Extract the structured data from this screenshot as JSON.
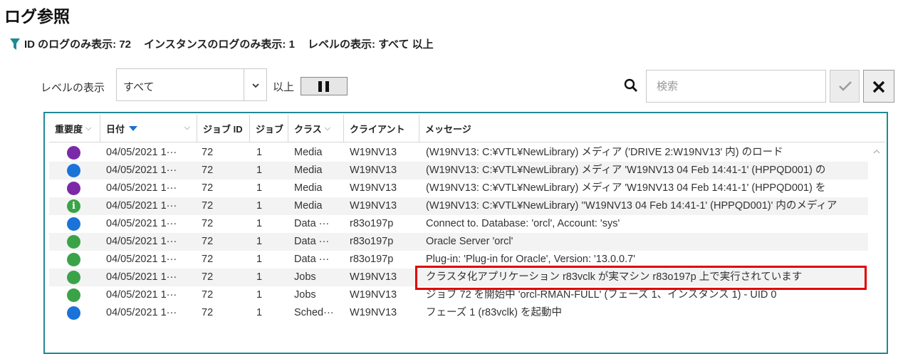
{
  "page": {
    "title": "ログ参照"
  },
  "filter_summary": {
    "segments": [
      "ID のログのみ表示: 72",
      "インスタンスのログのみ表示: 1",
      "レベルの表示: すべて 以上"
    ]
  },
  "toolbar": {
    "level_label": "レベルの表示",
    "level_value": "すべて",
    "above_label": "以上",
    "search_placeholder": "検索"
  },
  "grid": {
    "headers": {
      "severity": "重要度",
      "date": "日付",
      "job_id": "ジョブ ID",
      "job": "ジョブ",
      "class": "クラス",
      "client": "クライアント",
      "message": "メッセージ"
    },
    "rows": [
      {
        "severity": "purple",
        "date": "04/05/2021 1···",
        "job_id": "72",
        "job": "1",
        "class": "Media",
        "client": "W19NV13",
        "message": "(W19NV13: C:¥VTL¥NewLibrary) メディア ('DRIVE 2:W19NV13' 内) のロード"
      },
      {
        "severity": "blue",
        "date": "04/05/2021 1···",
        "job_id": "72",
        "job": "1",
        "class": "Media",
        "client": "W19NV13",
        "message": "(W19NV13: C:¥VTL¥NewLibrary) メディア 'W19NV13 04 Feb 14:41-1' (HPPQD001) の"
      },
      {
        "severity": "purple",
        "date": "04/05/2021 1···",
        "job_id": "72",
        "job": "1",
        "class": "Media",
        "client": "W19NV13",
        "message": "(W19NV13: C:¥VTL¥NewLibrary) メディア 'W19NV13 04 Feb 14:41-1' (HPPQD001) を"
      },
      {
        "severity": "info",
        "date": "04/05/2021 1···",
        "job_id": "72",
        "job": "1",
        "class": "Media",
        "client": "W19NV13",
        "message": "(W19NV13: C:¥VTL¥NewLibrary) ''W19NV13 04 Feb 14:41-1' (HPPQD001)' 内のメディア"
      },
      {
        "severity": "blue",
        "date": "04/05/2021 1···",
        "job_id": "72",
        "job": "1",
        "class": "Data ···",
        "client": "r83o197p",
        "message": "Connect to. Database: 'orcl', Account: 'sys'"
      },
      {
        "severity": "green",
        "date": "04/05/2021 1···",
        "job_id": "72",
        "job": "1",
        "class": "Data ···",
        "client": "r83o197p",
        "message": "Oracle Server 'orcl'"
      },
      {
        "severity": "green",
        "date": "04/05/2021 1···",
        "job_id": "72",
        "job": "1",
        "class": "Data ···",
        "client": "r83o197p",
        "message": "Plug-in: 'Plug-in for Oracle', Version: '13.0.0.7'"
      },
      {
        "severity": "green",
        "date": "04/05/2021 1···",
        "job_id": "72",
        "job": "1",
        "class": "Jobs",
        "client": "W19NV13",
        "message": "クラスタ化アプリケーション r83vclk が実マシン r83o197p 上で実行されています"
      },
      {
        "severity": "green",
        "date": "04/05/2021 1···",
        "job_id": "72",
        "job": "1",
        "class": "Jobs",
        "client": "W19NV13",
        "message": "ジョブ 72 を開始中 'orcl-RMAN-FULL' (フェーズ 1、インスタンス 1) - UID 0"
      },
      {
        "severity": "blue",
        "date": "04/05/2021 1···",
        "job_id": "72",
        "job": "1",
        "class": "Sched···",
        "client": "W19NV13",
        "message": "フェーズ 1 (r83vclk) を起動中"
      }
    ]
  },
  "colors": {
    "accent": "#1f8a93",
    "severity_purple": "#7a2aa8",
    "severity_blue": "#1a73d9",
    "severity_green": "#3aa348",
    "highlight": "#e00000"
  }
}
